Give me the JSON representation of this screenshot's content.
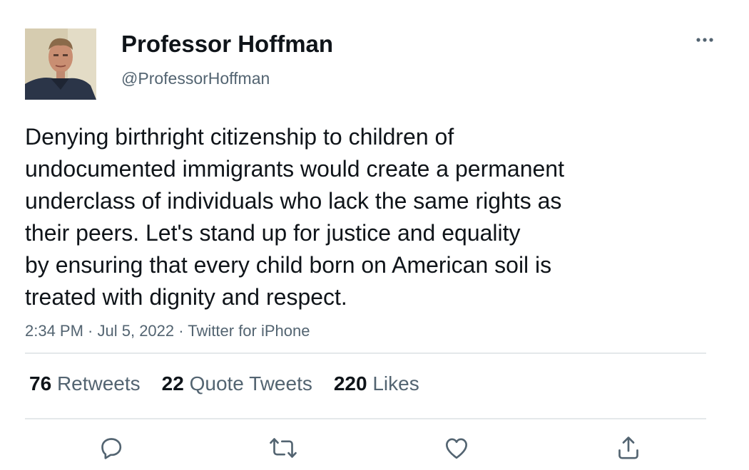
{
  "author": {
    "display_name": "Professor Hoffman",
    "handle": "@ProfessorHoffman",
    "avatar_icon": "user-photo"
  },
  "more_icon": "more-horizontal-icon",
  "tweet": {
    "lines": [
      "Denying birthright citizenship to children of",
      "undocumented immigrants would create a permanent",
      "underclass of individuals who lack the same rights as",
      "their peers. Let's stand up for justice and equality",
      "by ensuring that every child born on American soil is",
      "treated with dignity and respect."
    ]
  },
  "meta": {
    "time": "2:34 PM",
    "separator": " · ",
    "date": "Jul 5, 2022",
    "source": "Twitter for iPhone"
  },
  "stats": {
    "retweets": {
      "count": "76",
      "label": "Retweets"
    },
    "quotes": {
      "count": "22",
      "label": "Quote Tweets"
    },
    "likes": {
      "count": "220",
      "label": "Likes"
    }
  },
  "actions": [
    "reply-icon",
    "retweet-icon",
    "like-icon",
    "share-icon"
  ],
  "colors": {
    "text": "#0f1419",
    "secondary": "#536471",
    "divider": "#e4e8ea",
    "icon": "#536471"
  }
}
